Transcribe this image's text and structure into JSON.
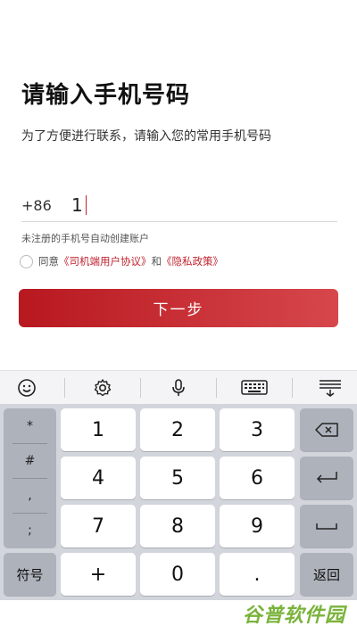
{
  "page": {
    "title": "请输入手机号码",
    "subtitle": "为了方便进行联系，请输入您的常用手机号码",
    "country_code": "+86",
    "phone_value": "1",
    "hint": "未注册的手机号自动创建账户",
    "agree_prefix": "同意",
    "agree_link1": "《司机端用户协议》",
    "agree_mid": "和",
    "agree_link2": "《隐私政策》",
    "next_label": "下一步"
  },
  "keyboard": {
    "toolbar_icons": [
      "emoji-icon",
      "settings-gear-icon",
      "microphone-icon",
      "keyboard-icon",
      "hide-keyboard-icon"
    ],
    "symbols": [
      "*",
      "#",
      ",",
      ";"
    ],
    "rows": [
      [
        "1",
        "2",
        "3"
      ],
      [
        "4",
        "5",
        "6"
      ],
      [
        "7",
        "8",
        "9"
      ]
    ],
    "symbol_switch": "符号",
    "plus": "+",
    "zero": "0",
    "dot": ".",
    "return_label": "返回"
  },
  "watermark": "谷普软件园",
  "colors": {
    "accent": "#c0232f",
    "watermark": "#7ab33b"
  }
}
